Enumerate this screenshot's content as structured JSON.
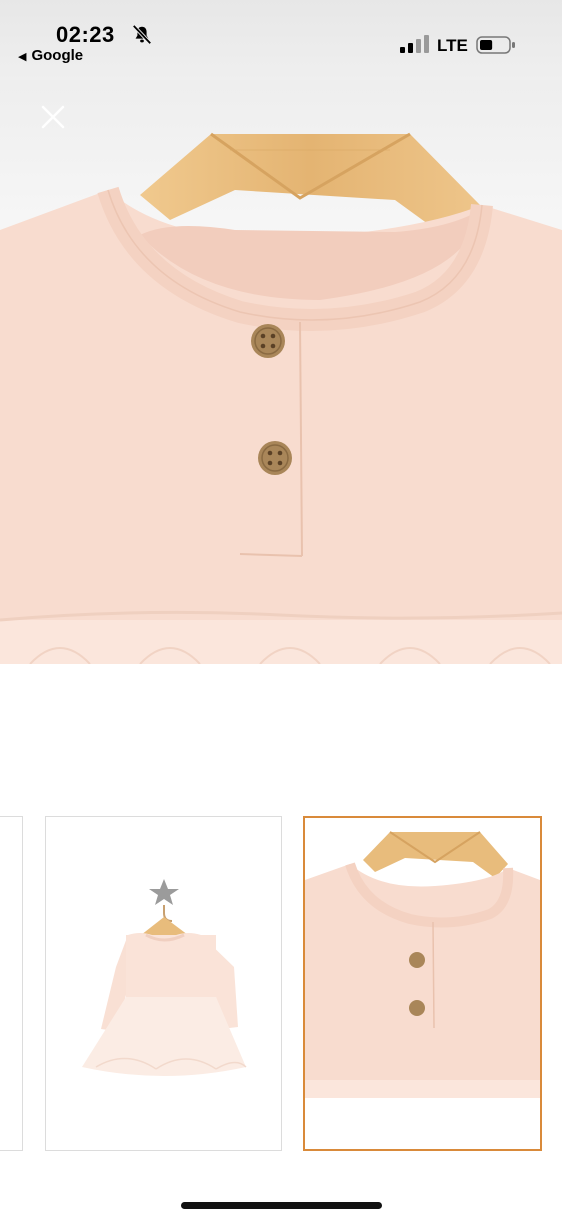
{
  "status_bar": {
    "time": "02:23",
    "back_app": "Google",
    "network": "LTE",
    "silent_icon": "bell-slash-icon",
    "signal_icon": "cellular-signal-icon",
    "battery_icon": "battery-icon",
    "battery_level": 0.45
  },
  "viewer": {
    "close_icon": "close-icon",
    "selected_index": 2,
    "thumbnails": [
      {
        "name": "product-photo-1"
      },
      {
        "name": "dress-on-hanger-photo"
      },
      {
        "name": "dress-collar-closeup-photo"
      }
    ]
  },
  "colors": {
    "fabric": "#f8dccf",
    "wood": "#e8bc7c",
    "button": "#a98659",
    "selected_border": "#d98a3a"
  }
}
